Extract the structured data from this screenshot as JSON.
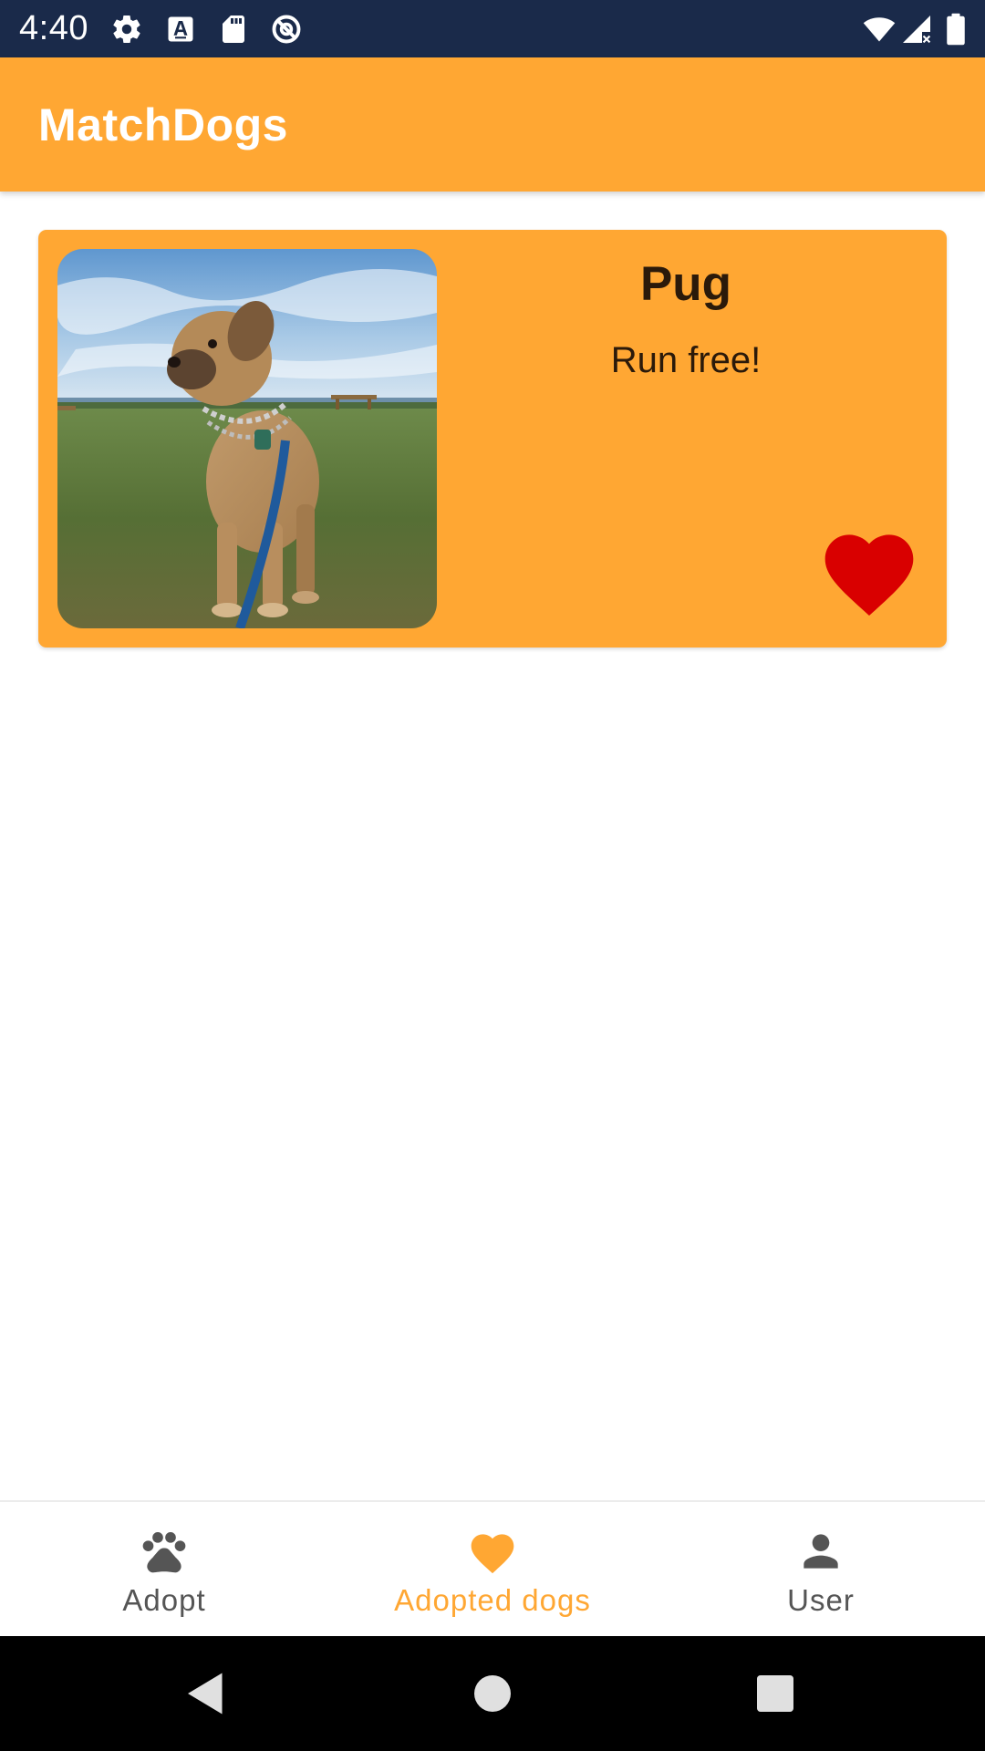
{
  "status_bar": {
    "time": "4:40",
    "left_icons": [
      "settings-gear-icon",
      "text-a-icon",
      "sd-card-icon",
      "no-disturb-icon"
    ],
    "right_icons": [
      "wifi-icon",
      "cellular-signal-icon",
      "battery-icon"
    ]
  },
  "app_bar": {
    "title": "MatchDogs"
  },
  "dog_card": {
    "name": "Pug",
    "description": "Run free!",
    "favorite_icon": "heart-icon",
    "favorite": true
  },
  "bottom_nav": {
    "items": [
      {
        "label": "Adopt",
        "icon": "paw-icon",
        "active": false
      },
      {
        "label": "Adopted dogs",
        "icon": "heart-icon",
        "active": true
      },
      {
        "label": "User",
        "icon": "person-icon",
        "active": false
      }
    ]
  },
  "system_nav": {
    "buttons": [
      "back-icon",
      "home-icon",
      "recents-icon"
    ]
  },
  "colors": {
    "status_bar": "#1a2a4a",
    "primary": "#ffa733",
    "favorite_heart": "#d90000",
    "nav_inactive": "#555555",
    "text_dark": "#2b1a0a"
  }
}
